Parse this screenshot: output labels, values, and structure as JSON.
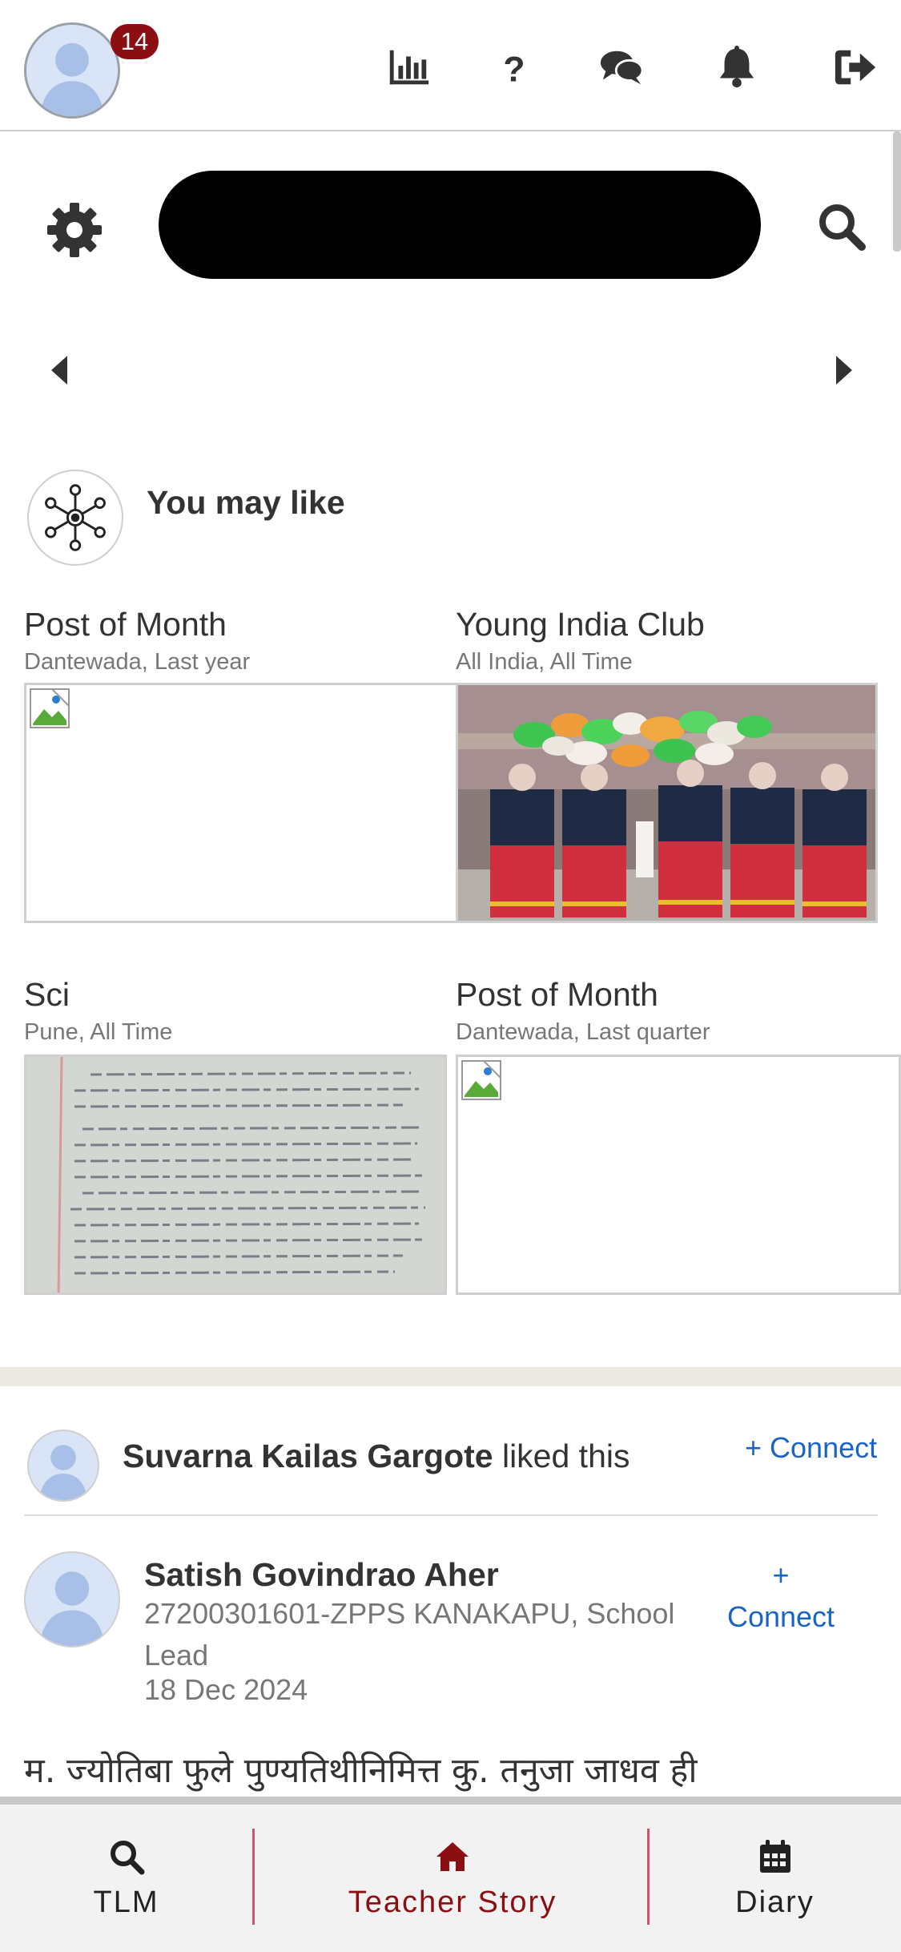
{
  "header": {
    "notification_count": "14",
    "icons": [
      "bar-chart-icon",
      "help-icon",
      "chat-icon",
      "bell-icon",
      "logout-icon"
    ]
  },
  "search": {
    "placeholder": ""
  },
  "you_may_like": {
    "title": "You may like",
    "cards": [
      {
        "title": "Post of Month",
        "subtitle": "Dantewada, Last year",
        "image": "broken"
      },
      {
        "title": "Young India Club",
        "subtitle": "All India, All Time",
        "image": "group-photo-balloons"
      },
      {
        "title": "Sci",
        "subtitle": "Pune, All Time",
        "image": "handwritten-notes"
      },
      {
        "title": "Post of Month",
        "subtitle": "Dantewada, Last quarter",
        "image": "broken"
      }
    ]
  },
  "feed": {
    "liked_by_name": "Suvarna Kailas Gargote",
    "liked_suffix": " liked this",
    "connect_label": "+ Connect",
    "connect_plus": "+",
    "connect_word": "Connect",
    "author_name": "Satish Govindrao Aher",
    "author_school": "27200301601-ZPPS KANAKAPU, School Lead",
    "post_date": "18 Dec 2024",
    "post_text": "म. ज्योतिबा फुले पुण्यतिथीनिमित्त कु. तनुजा जाधव ही"
  },
  "bottom_nav": {
    "items": [
      {
        "label": "TLM",
        "icon": "search-icon"
      },
      {
        "label": "Teacher Story",
        "icon": "home-icon",
        "active": true
      },
      {
        "label": "Diary",
        "icon": "calendar-icon"
      }
    ]
  },
  "colors": {
    "accent": "#8b0f12",
    "link": "#1a63c7",
    "active_nav": "#8b0f12"
  }
}
